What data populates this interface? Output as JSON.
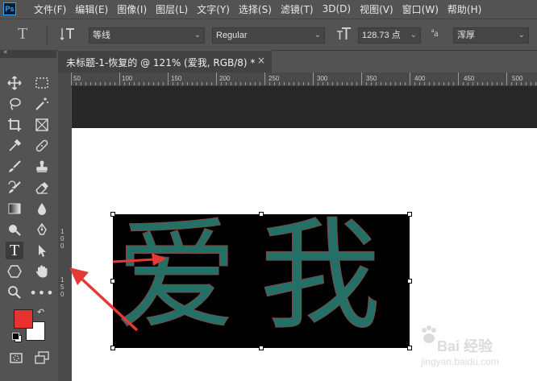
{
  "menubar": {
    "logo": "Ps",
    "items": [
      "文件(F)",
      "编辑(E)",
      "图像(I)",
      "图层(L)",
      "文字(Y)",
      "选择(S)",
      "滤镜(T)",
      "3D(D)",
      "视图(V)",
      "窗口(W)",
      "帮助(H)"
    ]
  },
  "options": {
    "tool_glyph": "T",
    "font_family": "等线",
    "font_style": "Regular",
    "font_size": "128.73 点",
    "aa_glyph": "ªa",
    "anti_alias": "浑厚"
  },
  "tab": {
    "title": "未标题-1-恢复的 @ 121% (爱我, RGB/8) *",
    "close": "×"
  },
  "ruler": {
    "top": [
      "50",
      "100",
      "150",
      "200",
      "250",
      "300",
      "350",
      "400",
      "450",
      "500"
    ],
    "left": [
      "1",
      "0",
      "0",
      "1",
      "5",
      "0"
    ]
  },
  "canvas": {
    "text": "爱我",
    "text_color": "#247067",
    "background": "#000000"
  },
  "colors": {
    "foreground": "#e8322d",
    "background": "#ffffff",
    "annotation_arrow": "#e53935"
  },
  "watermark": {
    "brand": "Bai 经验",
    "url": "jingyan.baidu.com"
  }
}
